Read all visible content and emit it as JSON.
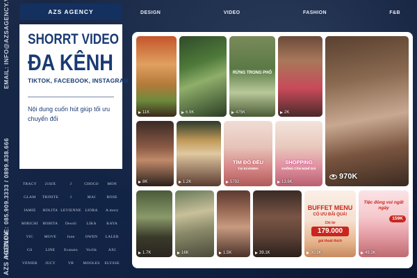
{
  "sidebar": {
    "email": "EMAIL: INFO@AZSAGENCY.VN",
    "hotline": "HOTLINE: 085.909.3333 / 0899.838.666",
    "brand_vertical": "AZS AGENCY"
  },
  "nav": {
    "items": [
      "DESIGN",
      "VIDEO",
      "FASHION",
      "F&B"
    ]
  },
  "card": {
    "agency_name": "AZS AGENCY",
    "title_line1": "SHORRT VIDEO",
    "title_line2": "ĐA KÊNH",
    "platforms": "TIKTOK, FACEBOOK, INSTAGRAM",
    "description": "Nội dung cuốn hút giúp tối ưu chuyển đổi"
  },
  "logos": [
    "TRACY",
    "21SIX",
    "J",
    "CHOCO",
    "MON",
    "GLAM",
    "TRINITE",
    "J",
    "MAI",
    "ROSE",
    "JAMIE",
    "HOLITA",
    "LEVIENNE",
    "LIORA",
    "A.mory",
    "MIRICHI",
    "BOBITA",
    "Desoli",
    "LIKA",
    "KAYA",
    "VIC",
    "MOVE",
    "June",
    "OWEN",
    "LALER",
    "GS",
    "LINE",
    "Ecanato",
    "Vorlik",
    "AXI",
    "VENIER",
    "JUCY",
    "VB",
    "MOOLES",
    "ELYSSE"
  ],
  "thumbs": [
    {
      "views": "11K",
      "overlay": ""
    },
    {
      "views": "6.9K",
      "overlay": ""
    },
    {
      "views": "475K",
      "overlay": "RỪNG TRONG PHỐ"
    },
    {
      "views": "2K",
      "overlay": ""
    },
    {
      "views": "970K",
      "overlay": ""
    },
    {
      "views": "8K",
      "overlay": ""
    },
    {
      "views": "1.2K",
      "overlay": ""
    },
    {
      "views": "5792",
      "overlay": "TÌM ĐỒ ĐỀU"
    },
    {
      "views": "13.6K",
      "overlay": "SHOPPING"
    },
    {
      "views": "1.7K",
      "overlay": ""
    },
    {
      "views": "16K",
      "overlay": ""
    },
    {
      "views": "1.5K",
      "overlay": ""
    },
    {
      "views": "39.1K",
      "overlay": ""
    },
    {
      "views": "30.9K",
      "overlay": "BUFFET MENU"
    },
    {
      "views": "49.3K",
      "overlay": "Tiệc đông vui ngất ngây"
    }
  ],
  "promo": {
    "sub_tim_do": "TẠI ELVANNA",
    "sub_shopping": "KHÔNG CẦN NGHĨ GIÁ",
    "buffet_sub": "CÓ ƯU ĐÃI QUÁ!",
    "buffet_price": "179.000",
    "buffet_price_label": "Chỉ từ",
    "buffet_tag": "giá thoải thích",
    "tiec_price": "159K"
  },
  "colors": {
    "navy": "#14305e",
    "title_blue": "#1a3a72",
    "background": "#0e1f3d",
    "promo_red": "#c8261e"
  }
}
